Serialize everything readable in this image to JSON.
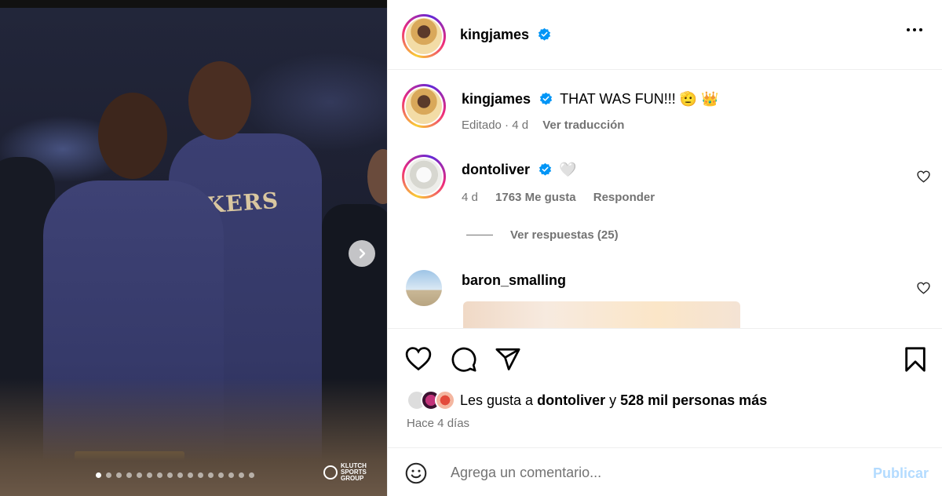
{
  "post": {
    "author": "kingjames",
    "more_icon": "more-horizontal-icon",
    "next_icon": "chevron-right-icon",
    "carousel": {
      "total": 16,
      "active_index": 0
    },
    "watermark": [
      "KLUTCH",
      "SPORTS",
      "GROUP"
    ],
    "jersey_text": "KERS"
  },
  "caption": {
    "author": "kingjames",
    "text": "THAT WAS FUN!!! 🫡 👑",
    "edited_label": "Editado · 4 d",
    "translate_label": "Ver traducción"
  },
  "comments": [
    {
      "author": "dontoliver",
      "text": "🤍",
      "age": "4 d",
      "likes": "1763 Me gusta",
      "reply_label": "Responder",
      "view_replies": "Ver respuestas (25)"
    },
    {
      "author": "baron_smalling",
      "text": ""
    }
  ],
  "actions": {
    "like_icon": "heart-icon",
    "comment_icon": "comment-icon",
    "share_icon": "send-icon",
    "save_icon": "bookmark-icon"
  },
  "likes": {
    "prefix": "Les gusta a ",
    "user": "dontoliver",
    "joiner": " y ",
    "others": "528 mil personas más"
  },
  "timestamp": "Hace 4 días",
  "add_comment": {
    "placeholder": "Agrega un comentario...",
    "post_label": "Publicar",
    "emoji_icon": "emoji-icon"
  },
  "colors": {
    "verified": "#0095f6",
    "muted": "#737373",
    "post_disabled": "#b3dbff",
    "ring": [
      "#f9ce34",
      "#ee2a7b",
      "#6228d7"
    ]
  }
}
